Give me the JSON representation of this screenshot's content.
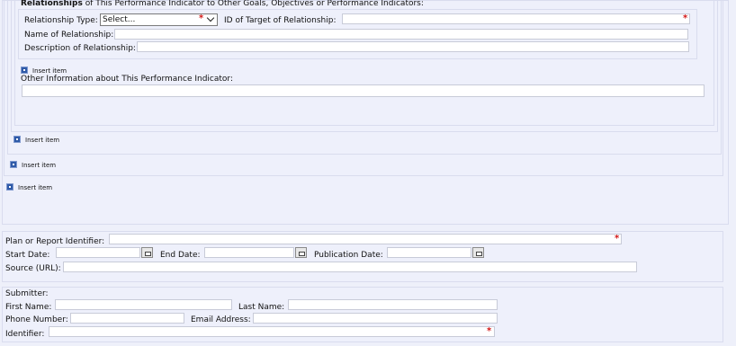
{
  "relationships": {
    "heading_bold": "Relationships",
    "heading_rest": " of This Performance Indicator to Other Goals, Objectives or Performance Indicators:",
    "type_label": "Relationship Type:",
    "type_select_value": "Select...",
    "target_id_label": "ID of Target of Relationship:",
    "name_label": "Name of Relationship:",
    "description_label": "Description of Relationship:",
    "insert_item": "Insert item"
  },
  "other_info": {
    "label": "Other Information about This Performance Indicator:"
  },
  "insert_items": [
    "Insert item",
    "Insert item",
    "Insert item"
  ],
  "plan": {
    "identifier_label": "Plan or Report Identifier:",
    "start_date_label": "Start Date:",
    "end_date_label": "End Date:",
    "publication_date_label": "Publication Date:",
    "source_label": "Source (URL):"
  },
  "submitter": {
    "heading": "Submitter:",
    "first_name_label": "First Name:",
    "last_name_label": "Last Name:",
    "phone_label": "Phone Number:",
    "email_label": "Email Address:",
    "identifier_label": "Identifier:"
  },
  "required_marker": "*",
  "colors": {
    "background": "#eef0fa",
    "required": "#d21414",
    "insert_icon": "#2f5aa8"
  }
}
